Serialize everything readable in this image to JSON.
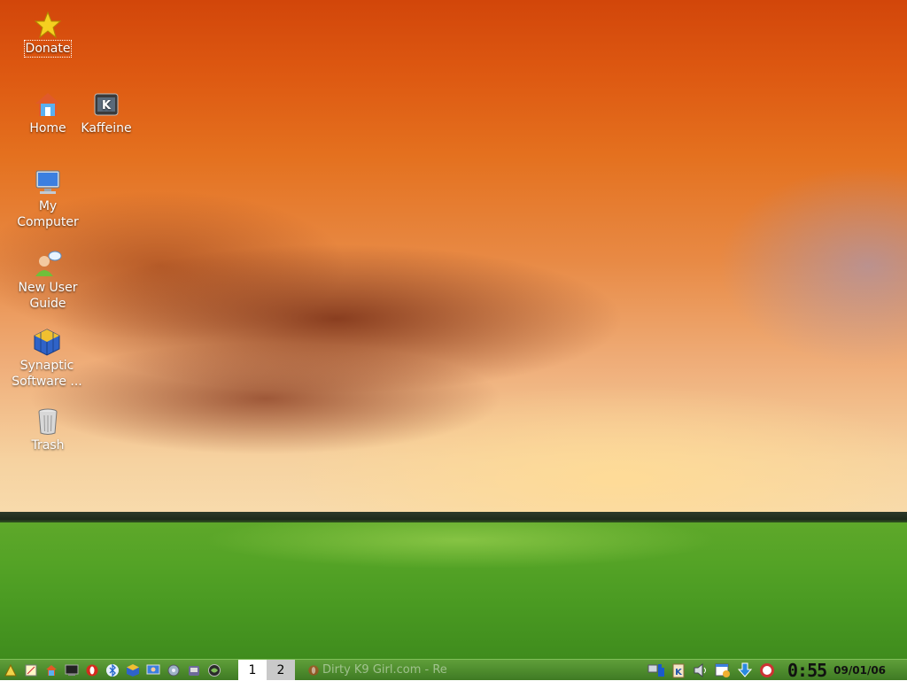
{
  "desktop": {
    "icons": [
      {
        "label": "Donate",
        "icon": "star-icon"
      },
      {
        "label": "Home",
        "icon": "home-folder-icon"
      },
      {
        "label": "Kaffeine",
        "icon": "kaffeine-icon"
      },
      {
        "label": "My\nComputer",
        "icon": "computer-monitor-icon"
      },
      {
        "label": "New User\nGuide",
        "icon": "user-guide-icon"
      },
      {
        "label": "Synaptic\nSoftware ...",
        "icon": "synaptic-package-icon"
      },
      {
        "label": "Trash",
        "icon": "trash-icon"
      }
    ]
  },
  "taskbar": {
    "launchers": [
      "kmenu-icon",
      "text-editor-icon",
      "file-manager-icon",
      "terminal-icon",
      "opera-browser-icon",
      "bluetooth-icon",
      "synaptic-icon",
      "remote-desktop-icon",
      "settings-icon",
      "pidgin-icon",
      "browser-globe-icon"
    ],
    "pager": [
      {
        "label": "1",
        "active": true
      },
      {
        "label": "2",
        "active": false
      }
    ],
    "task_label": "Dirty K9 Girl.com - Re",
    "tray": [
      "network-icon",
      "klipper-icon",
      "volume-icon",
      "calendar-user-icon",
      "update-arrow-icon",
      "lifebuoy-icon"
    ],
    "clock_time": "0:55",
    "clock_date": "09/01/06"
  }
}
